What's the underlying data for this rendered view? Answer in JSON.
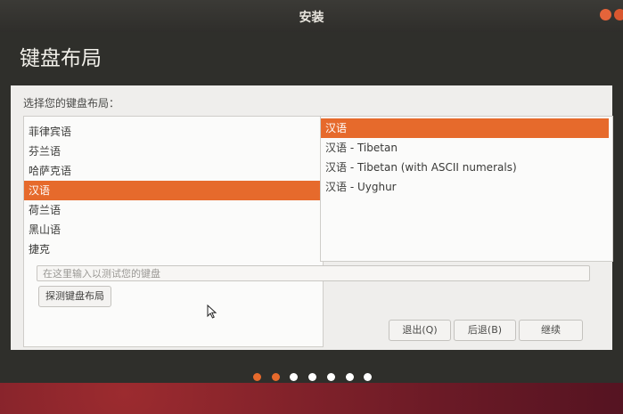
{
  "window": {
    "title": "安装"
  },
  "page": {
    "heading": "键盘布局"
  },
  "layout_prompt": "选择您的键盘布局：",
  "languages": [
    {
      "label": "菲律宾语",
      "selected": false
    },
    {
      "label": "芬兰语",
      "selected": false
    },
    {
      "label": "哈萨克语",
      "selected": false
    },
    {
      "label": "汉语",
      "selected": true
    },
    {
      "label": "荷兰语",
      "selected": false
    },
    {
      "label": "黑山语",
      "selected": false
    },
    {
      "label": "捷克",
      "selected": false
    }
  ],
  "variants": [
    {
      "label": "汉语",
      "selected": true
    },
    {
      "label": "汉语 - Tibetan",
      "selected": false
    },
    {
      "label": "汉语 - Tibetan (with ASCII numerals)",
      "selected": false
    },
    {
      "label": "汉语 - Uyghur",
      "selected": false
    }
  ],
  "test_input": {
    "placeholder": "在这里输入以测试您的键盘",
    "value": ""
  },
  "detect_button": "探测键盘布局",
  "buttons": {
    "quit": "退出(Q)",
    "back": "后退(B)",
    "continue": "继续"
  },
  "progress": {
    "total_steps": 7,
    "completed_steps": 2
  },
  "colors": {
    "accent": "#e66a2c",
    "titlebar": "#2f2e2b",
    "dot_inactive": "#ffffff",
    "wallpaper": "#6b1a26"
  }
}
